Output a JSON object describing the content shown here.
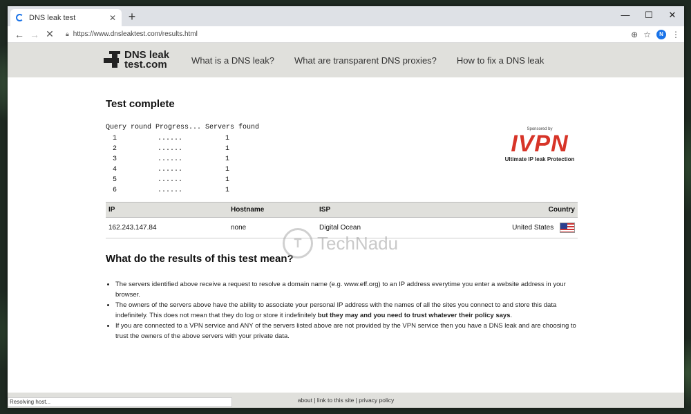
{
  "browser": {
    "tab_title": "DNS leak test",
    "tab_close": "✕",
    "new_tab": "+",
    "url": "https://www.dnsleaktest.com/results.html",
    "win_min": "—",
    "win_max": "☐",
    "win_close": "✕",
    "avatar": "N"
  },
  "site": {
    "logo_line1": "DNS leak",
    "logo_line2": "test.com",
    "nav": [
      "What is a DNS leak?",
      "What are transparent DNS proxies?",
      "How to fix a DNS leak"
    ]
  },
  "test": {
    "title": "Test complete",
    "header": "Query round Progress... Servers found",
    "rounds": [
      {
        "round": "1",
        "progress": "......",
        "servers": "1"
      },
      {
        "round": "2",
        "progress": "......",
        "servers": "1"
      },
      {
        "round": "3",
        "progress": "......",
        "servers": "1"
      },
      {
        "round": "4",
        "progress": "......",
        "servers": "1"
      },
      {
        "round": "5",
        "progress": "......",
        "servers": "1"
      },
      {
        "round": "6",
        "progress": "......",
        "servers": "1"
      }
    ]
  },
  "sponsor": {
    "by": "Sponsored by",
    "brand": "IVPN",
    "tagline": "Ultimate IP leak Protection"
  },
  "results": {
    "columns": [
      "IP",
      "Hostname",
      "ISP",
      "Country"
    ],
    "rows": [
      {
        "ip": "162.243.147.84",
        "hostname": "none",
        "isp": "Digital Ocean",
        "country": "United States"
      }
    ]
  },
  "meaning": {
    "title": "What do the results of this test mean?",
    "items": [
      {
        "text": "The servers identified above receive a request to resolve a domain name (e.g. www.eff.org) to an IP address everytime you enter a website address in your browser.",
        "bold": ""
      },
      {
        "text": "The owners of the servers above have the ability to associate your personal IP address with the names of all the sites you connect to and store this data indefinitely. This does not mean that they do log or store it indefinitely ",
        "bold": "but they may and you need to trust whatever their policy says",
        "tail": "."
      },
      {
        "text": "If you are connected to a VPN service and ANY of the servers listed above are not provided by the VPN service then you have a DNS leak and are choosing to trust the owners of the above servers with your private data.",
        "bold": ""
      }
    ]
  },
  "footer": {
    "about": "about",
    "sep1": " | ",
    "link": "link to this site",
    "sep2": " | ",
    "privacy": "privacy policy"
  },
  "status": "Resolving host...",
  "watermark": "TechNadu",
  "watermark_mark": "T"
}
